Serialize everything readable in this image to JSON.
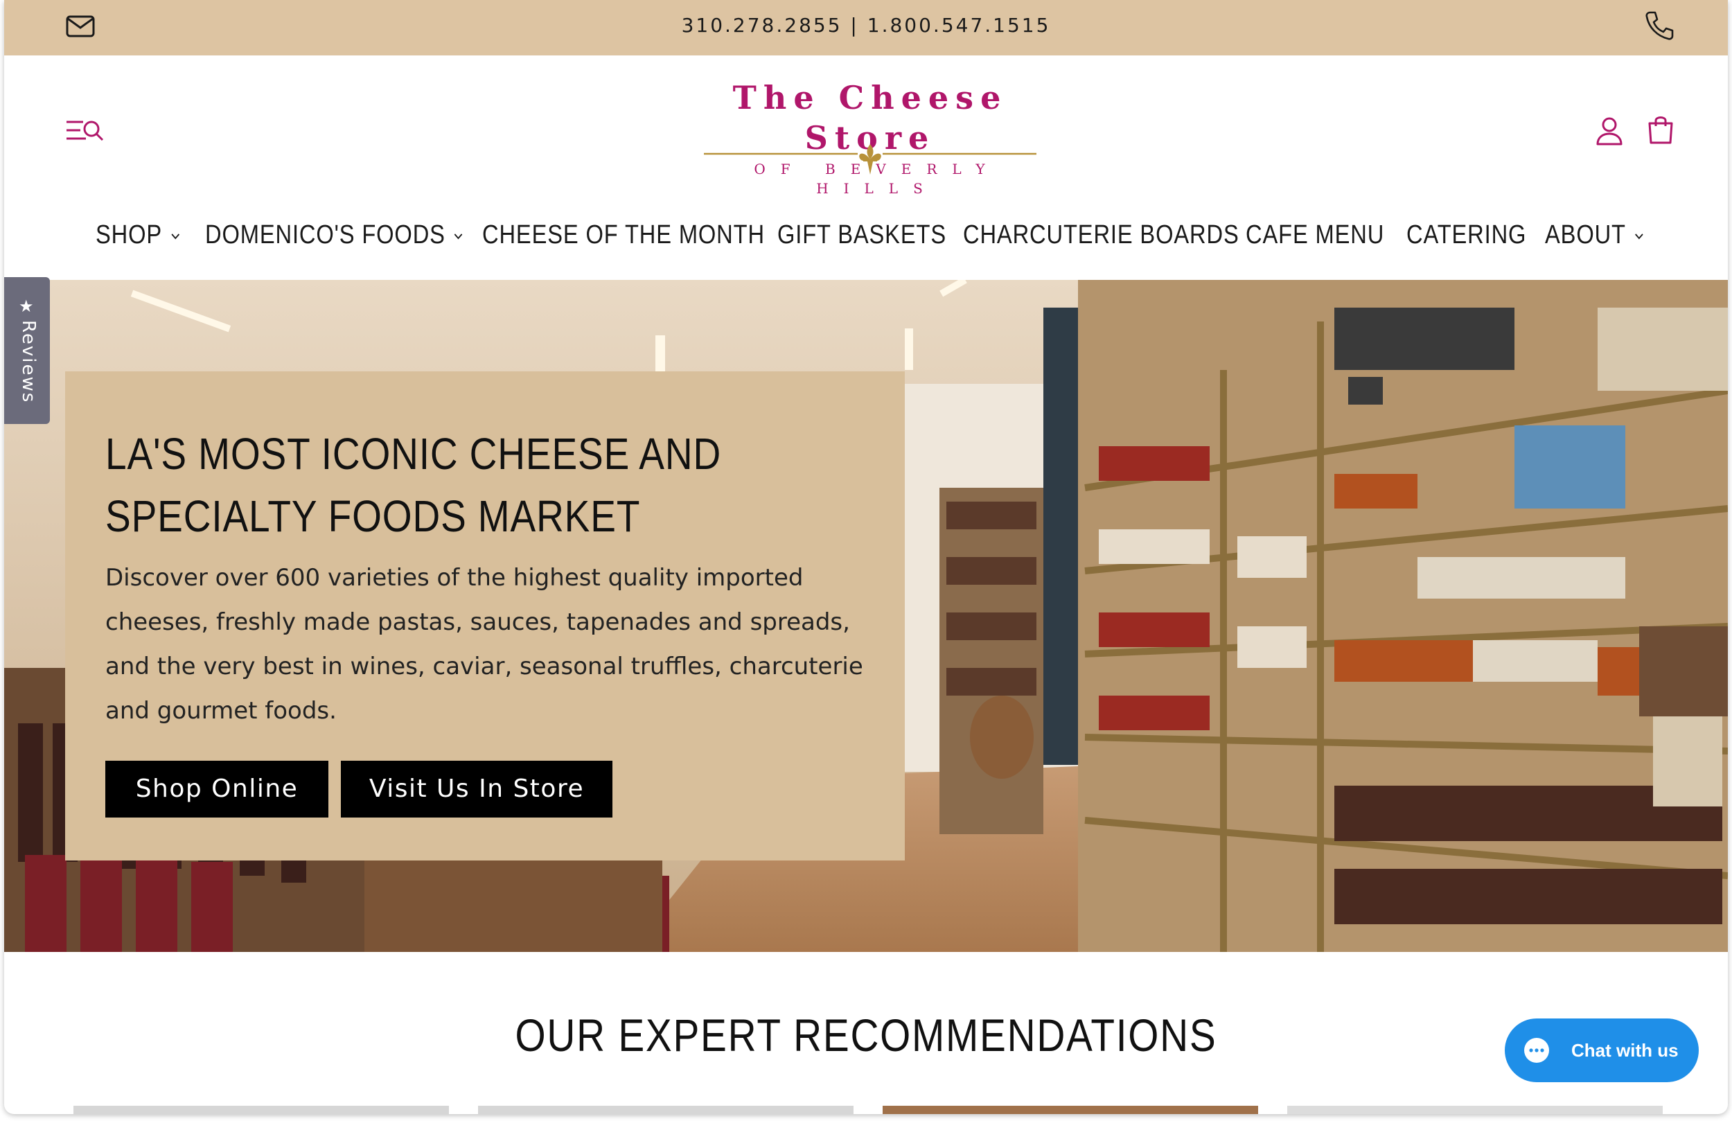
{
  "topbar": {
    "phones": "310.278.2855 | 1.800.547.1515",
    "mail_icon": "mail-icon",
    "phone_icon": "phone-icon"
  },
  "header": {
    "logo_title": "The Cheese Store",
    "logo_subtitle": "OF BEVERLY HILLS",
    "icons": [
      "menu-search-icon",
      "account-icon",
      "cart-icon"
    ]
  },
  "nav": {
    "items": [
      {
        "label": "SHOP",
        "has_dropdown": true
      },
      {
        "label": "DOMENICO'S FOODS",
        "has_dropdown": true
      },
      {
        "label": "CHEESE OF THE MONTH",
        "has_dropdown": false
      },
      {
        "label": "GIFT BASKETS",
        "has_dropdown": false
      },
      {
        "label": "CHARCUTERIE BOARDS",
        "has_dropdown": false
      },
      {
        "label": "CAFE MENU",
        "has_dropdown": false
      },
      {
        "label": "CATERING",
        "has_dropdown": false
      },
      {
        "label": "ABOUT",
        "has_dropdown": true
      }
    ]
  },
  "reviews_tab": {
    "label": "Reviews"
  },
  "hero": {
    "title_line1": "LA'S MOST ICONIC CHEESE AND",
    "title_line2": "SPECIALTY FOODS MARKET",
    "body": "Discover over 600 varieties of the highest quality imported cheeses, freshly made pastas, sauces, tapenades and spreads, and the very best in wines, caviar, seasonal truffles, charcuterie and gourmet foods.",
    "primary_button": "Shop Online",
    "secondary_button": "Visit Us In Store"
  },
  "recommendations": {
    "title": "OUR EXPERT RECOMMENDATIONS"
  },
  "chat": {
    "label": "Chat with us"
  },
  "colors": {
    "topbar_bg": "#ddc4a2",
    "brand_magenta": "#b0166a",
    "gold": "#b8923a",
    "hero_card_bg": "#d8bf9b",
    "button_bg": "#000000",
    "chat_blue": "#1f8fe8"
  }
}
